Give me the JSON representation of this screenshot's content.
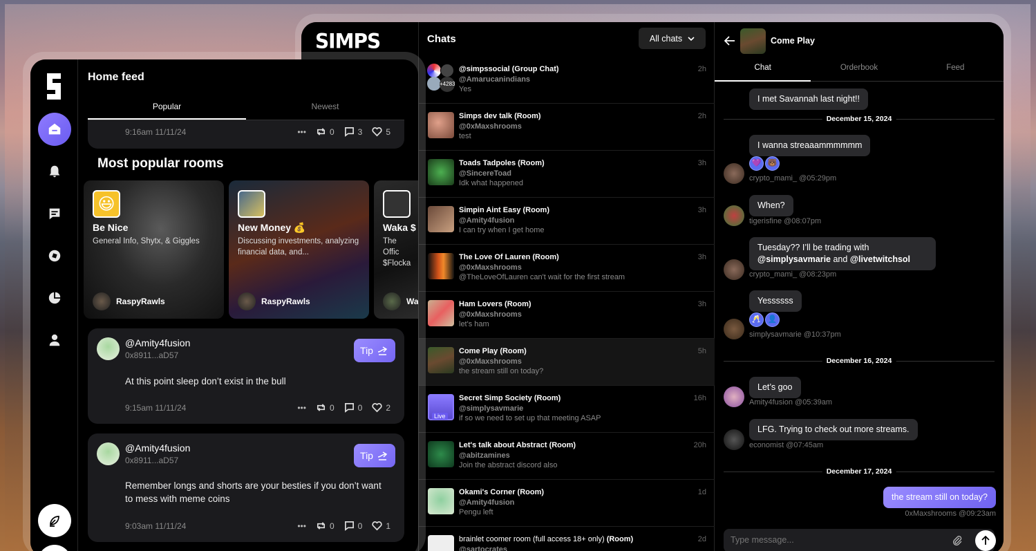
{
  "left_window": {
    "title": "Home feed",
    "tabs": [
      "Popular",
      "Newest"
    ],
    "top_post": {
      "time": "9:16am 11/11/24",
      "reposts": "0",
      "comments": "3",
      "likes": "5"
    },
    "section_title": "Most popular rooms",
    "rooms": [
      {
        "name": "Be Nice",
        "desc": "General Info, Shytx, & Giggles",
        "owner": "RaspyRawls"
      },
      {
        "name": "New Money 💰",
        "desc": "Discussing investments, analyzing financial data, and...",
        "owner": "RaspyRawls"
      },
      {
        "name": "Waka $",
        "desc": "The Offic $Flocka",
        "owner": "Wa"
      }
    ],
    "posts": [
      {
        "user": "@Amity4fusion",
        "addr": "0x8911...aD57",
        "text": "At this point sleep don’t exist in the bull",
        "time": "9:15am 11/11/24",
        "reposts": "0",
        "comments": "0",
        "likes": "2",
        "tip": "Tip"
      },
      {
        "user": "@Amity4fusion",
        "addr": "0x8911...aD57",
        "text": "Remember longs and shorts are your besties if you don’t want to mess with meme coins",
        "time": "9:03am 11/11/24",
        "reposts": "0",
        "comments": "0",
        "likes": "1",
        "tip": "Tip"
      }
    ]
  },
  "right_window": {
    "logo": "SIMPS",
    "chats_title": "Chats",
    "filter": "All chats",
    "chats": [
      {
        "title": "@simpssocial",
        "tag": "(Group Chat)",
        "sub": "@Amarucanindians",
        "msg": "Yes",
        "time": "2h",
        "badge": "+4283"
      },
      {
        "title": "Simps dev talk",
        "tag": "(Room)",
        "sub": "@0xMaxshrooms",
        "msg": "test",
        "time": "2h"
      },
      {
        "title": "Toads Tadpoles ",
        "tag": "(Room)",
        "sub": "@SincereToad",
        "msg": "Idk what happened",
        "time": "3h"
      },
      {
        "title": "Simpin Aint Easy",
        "tag": "(Room)",
        "sub": "@Amity4fusion",
        "msg": "I can try when I get home",
        "time": "3h"
      },
      {
        "title": "The Love Of Lauren",
        "tag": "(Room)",
        "sub": "@0xMaxshrooms",
        "msg": "@TheLoveOfLauren can't wait for the first stream",
        "time": "3h"
      },
      {
        "title": "Ham Lovers",
        "tag": "(Room)",
        "sub": "@0xMaxshrooms",
        "msg": "let's ham",
        "time": "3h"
      },
      {
        "title": "Come Play ",
        "tag": "(Room)",
        "sub": "@0xMaxshrooms",
        "msg": "the stream still on today?",
        "time": "5h"
      },
      {
        "title": "Secret Simp Society",
        "tag": "(Room)",
        "sub": "@simplysavmarie",
        "msg": "if so we need to set up that meeting ASAP",
        "time": "16h",
        "live": "Live"
      },
      {
        "title": "Let's talk about Abstract ",
        "tag": "(Room)",
        "sub": "@abitzamines",
        "msg": "Join the abstract discord also",
        "time": "20h"
      },
      {
        "title": "Okami's Corner",
        "tag": "(Room)",
        "sub": "@Amity4fusion",
        "msg": "Pengu left",
        "time": "1d"
      },
      {
        "title": "brainlet coomer room (full access 18+ only) ",
        "tag": "(Room)",
        "sub": "@sartocrates",
        "msg": "",
        "time": "2d"
      }
    ],
    "conversation": {
      "title": "Come Play",
      "tabs": [
        "Chat",
        "Orderbook",
        "Feed"
      ],
      "messages": [
        {
          "text": "I met Savannah last night!!"
        },
        {
          "date": "December 15, 2024"
        },
        {
          "text": "I wanna streaaammmmmm",
          "sender": "crypto_mami_ @05:29pm",
          "reactions": [
            "💜",
            "🐻"
          ]
        },
        {
          "text": "When?",
          "sender": "tigerisfine @08:07pm"
        },
        {
          "text": "Tuesday?? I’ll be trading with",
          "m1": "@simplysavmarie",
          "and": " and ",
          "m2": "@livetwitchsol",
          "sender": "crypto_mami_ @08:23pm"
        },
        {
          "text": "Yessssss",
          "sender": "simplysavmarie @10:37pm",
          "reactions": [
            "🥂",
            "👤"
          ]
        },
        {
          "date": "December 16, 2024"
        },
        {
          "text": "Let’s goo",
          "sender": "Amity4fusion @05:39am"
        },
        {
          "text": "LFG. Trying to check out more streams.",
          "sender": "economist @07:45am"
        },
        {
          "date": "December 17, 2024"
        },
        {
          "text": "the stream still on today?",
          "sender": "0xMaxshrooms @09:23am"
        }
      ],
      "composer_placeholder": "Type message..."
    }
  }
}
